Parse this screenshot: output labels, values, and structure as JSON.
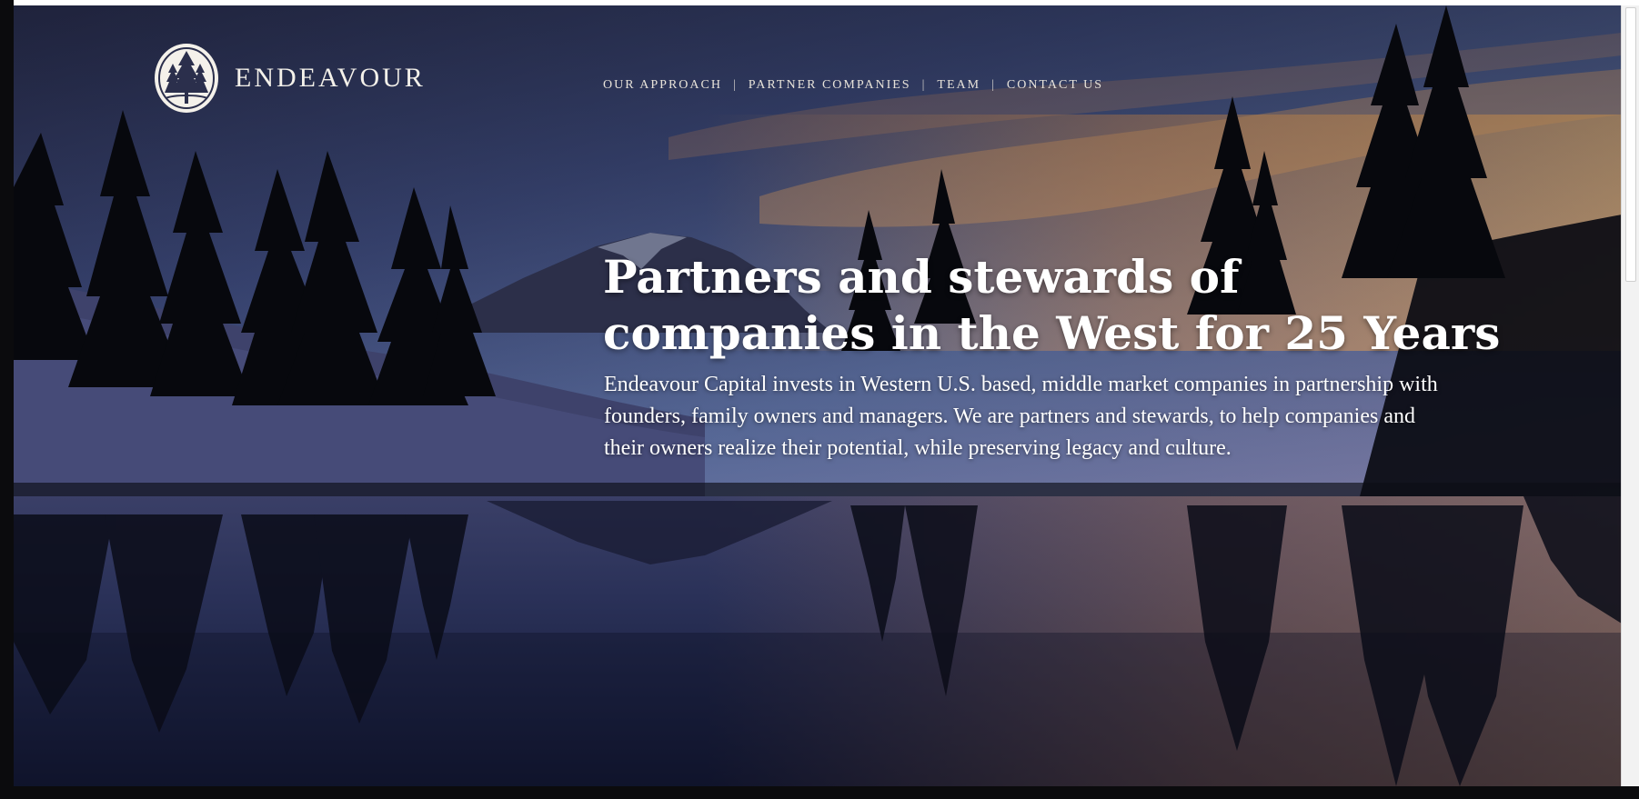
{
  "brand": {
    "name": "ENDEAVOUR",
    "logo_icon": "tree-seal-icon"
  },
  "nav": {
    "items": [
      {
        "label": "OUR APPROACH"
      },
      {
        "label": "PARTNER COMPANIES"
      },
      {
        "label": "TEAM"
      },
      {
        "label": "CONTACT US"
      }
    ],
    "separator": "|"
  },
  "hero": {
    "headline_line1": "Partners and stewards of",
    "headline_line2": "companies in the West for 25 Years",
    "body": "Endeavour Capital invests in Western U.S. based, middle market companies in partnership with founders, family owners and managers. We are partners and stewards, to help companies and their owners realize their potential, while preserving legacy and culture."
  },
  "colors": {
    "text": "#ffffff",
    "nav_text": "#e8e3da",
    "sky_dusk": "#3b4d7a",
    "sunset_glow": "#e8a25d",
    "silhouette": "#08090f"
  }
}
